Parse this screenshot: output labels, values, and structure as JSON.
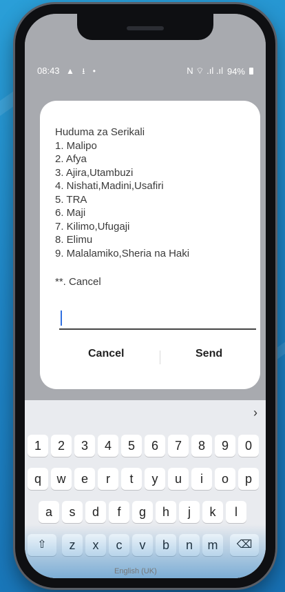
{
  "status_bar": {
    "time": "08:43",
    "left_icons": "▲ ⭳ •",
    "right_icons": "N ⌔ .ıl .ıl",
    "battery": "94%"
  },
  "dialog": {
    "title": "Huduma za Serikali",
    "options": [
      "1. Malipo",
      "2. Afya",
      "3. Ajira,Utambuzi",
      "4. Nishati,Madini,Usafiri",
      "5. TRA",
      "6. Maji",
      "7. Kilimo,Ufugaji",
      "8. Elimu",
      "9. Malalamiko,Sheria na Haki"
    ],
    "cancel_option": "**. Cancel",
    "input_value": "",
    "cancel_button": "Cancel",
    "send_button": "Send"
  },
  "keyboard": {
    "toolbar_chevron": "›",
    "number_row": [
      "1",
      "2",
      "3",
      "4",
      "5",
      "6",
      "7",
      "8",
      "9",
      "0"
    ],
    "row1": [
      "q",
      "w",
      "e",
      "r",
      "t",
      "y",
      "u",
      "i",
      "o",
      "p"
    ],
    "row2": [
      "a",
      "s",
      "d",
      "f",
      "g",
      "h",
      "j",
      "k",
      "l"
    ],
    "row3": [
      "z",
      "x",
      "c",
      "v",
      "b",
      "n",
      "m"
    ],
    "shift_glyph": "⇧",
    "backspace_glyph": "⌫",
    "space_label": "English (UK)"
  }
}
